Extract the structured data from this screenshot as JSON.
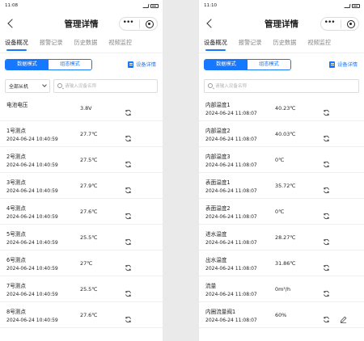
{
  "left_screen": {
    "status": {
      "time": "11:08"
    },
    "title": "管理详情",
    "tabs": [
      {
        "label": "设备概况",
        "active": true
      },
      {
        "label": "报警记录",
        "active": false
      },
      {
        "label": "历史数据",
        "active": false
      },
      {
        "label": "视频监控",
        "active": false
      }
    ],
    "modes": [
      {
        "label": "数据模式",
        "active": true
      },
      {
        "label": "组态模式",
        "active": false
      }
    ],
    "detail_link": "设备详情",
    "filter_select": "全部从机",
    "search_placeholder": "请输入设备名称",
    "rows": [
      {
        "name": "电池电压",
        "value": "3.8V",
        "time": ""
      },
      {
        "name": "1号测点",
        "value": "27.7℃",
        "time": "2024-06-24 10:40:59"
      },
      {
        "name": "2号测点",
        "value": "27.5℃",
        "time": "2024-06-24 10:40:59"
      },
      {
        "name": "3号测点",
        "value": "27.9℃",
        "time": "2024-06-24 10:40:59"
      },
      {
        "name": "4号测点",
        "value": "27.6℃",
        "time": "2024-06-24 10:40:59"
      },
      {
        "name": "5号测点",
        "value": "25.5℃",
        "time": "2024-06-24 10:40:59"
      },
      {
        "name": "6号测点",
        "value": "27℃",
        "time": "2024-06-24 10:40:59"
      },
      {
        "name": "7号测点",
        "value": "25.5℃",
        "time": "2024-06-24 10:40:59"
      },
      {
        "name": "8号测点",
        "value": "27.6℃",
        "time": "2024-06-24 10:40:59"
      }
    ]
  },
  "right_screen": {
    "status": {
      "time": "11:10"
    },
    "title": "管理详情",
    "tabs": [
      {
        "label": "设备概况",
        "active": true
      },
      {
        "label": "报警记录",
        "active": false
      },
      {
        "label": "历史数据",
        "active": false
      },
      {
        "label": "视频监控",
        "active": false
      }
    ],
    "modes": [
      {
        "label": "数据模式",
        "active": true
      },
      {
        "label": "组态模式",
        "active": false
      }
    ],
    "detail_link": "设备详情",
    "search_placeholder": "请输入设备名称",
    "rows": [
      {
        "name": "内部温度1",
        "value": "40.23℃",
        "time": "2024-06-24 11:08:07"
      },
      {
        "name": "内部温度2",
        "value": "40.03℃",
        "time": "2024-06-24 11:08:07"
      },
      {
        "name": "内部温度3",
        "value": "0℃",
        "time": "2024-06-24 11:08:07"
      },
      {
        "name": "表面温度1",
        "value": "35.72℃",
        "time": "2024-06-24 11:08:07"
      },
      {
        "name": "表面温度2",
        "value": "0℃",
        "time": "2024-06-24 11:08:07"
      },
      {
        "name": "进水温度",
        "value": "28.27℃",
        "time": "2024-06-24 11:08:07"
      },
      {
        "name": "出水温度",
        "value": "31.86℃",
        "time": "2024-06-24 11:08:07"
      },
      {
        "name": "流量",
        "value": "0m³/h",
        "time": "2024-06-24 11:08:07"
      },
      {
        "name": "内圈流量阀1",
        "value": "60%",
        "time": "2024-06-24 11:08:07",
        "editable": true
      }
    ]
  },
  "colors": {
    "accent": "#1677ff",
    "divider": "#eeeeee",
    "text": "#222222",
    "muted": "#888888"
  },
  "icons": [
    "back-arrow-icon",
    "more-dots-icon",
    "target-icon",
    "document-icon",
    "chevron-down-icon",
    "search-icon",
    "refresh-icon",
    "edit-pencil-icon"
  ]
}
